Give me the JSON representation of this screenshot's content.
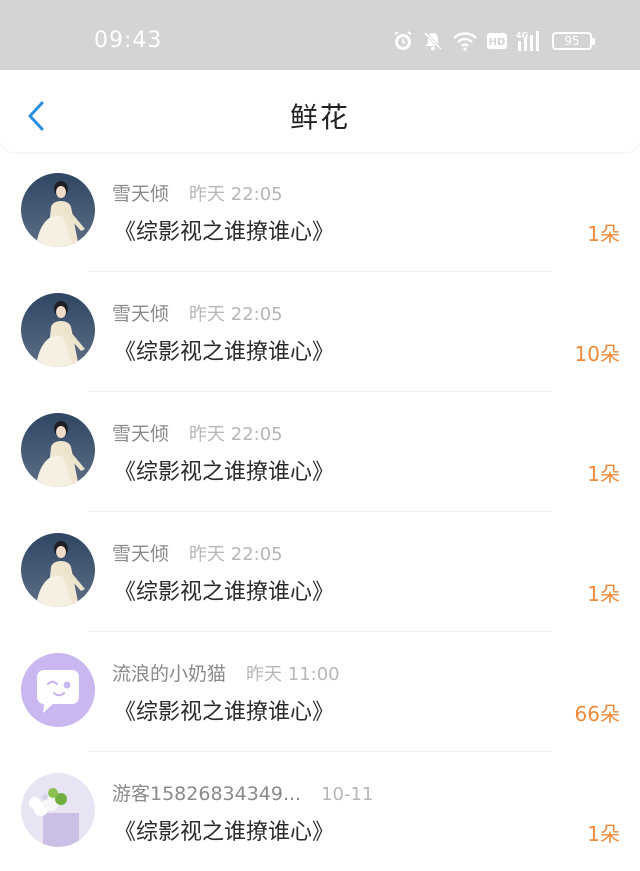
{
  "status_bar": {
    "time": "09:43",
    "icons": [
      "alarm-icon",
      "mute-icon",
      "wifi-icon",
      "hd-icon",
      "signal-4g-icon"
    ],
    "battery": "95",
    "color": "#d4d4d4"
  },
  "header": {
    "title": "鲜花",
    "back_icon": "chevron-left-icon",
    "accent": "#2a8ee0"
  },
  "flowers": [
    {
      "user": "雪天倾",
      "time": "昨天 22:05",
      "book": "《综影视之谁撩谁心》",
      "count": "1朵",
      "avatar": "portrait"
    },
    {
      "user": "雪天倾",
      "time": "昨天 22:05",
      "book": "《综影视之谁撩谁心》",
      "count": "10朵",
      "avatar": "portrait"
    },
    {
      "user": "雪天倾",
      "time": "昨天 22:05",
      "book": "《综影视之谁撩谁心》",
      "count": "1朵",
      "avatar": "portrait"
    },
    {
      "user": "雪天倾",
      "time": "昨天 22:05",
      "book": "《综影视之谁撩谁心》",
      "count": "1朵",
      "avatar": "portrait"
    },
    {
      "user": "流浪的小奶猫",
      "time": "昨天 11:00",
      "book": "《综影视之谁撩谁心》",
      "count": "66朵",
      "avatar": "default-chat"
    },
    {
      "user": "游客15826834349...",
      "time": "10-11",
      "book": "《综影视之谁撩谁心》",
      "count": "1朵",
      "avatar": "flowers"
    }
  ],
  "count_color": "#ee8a3a"
}
